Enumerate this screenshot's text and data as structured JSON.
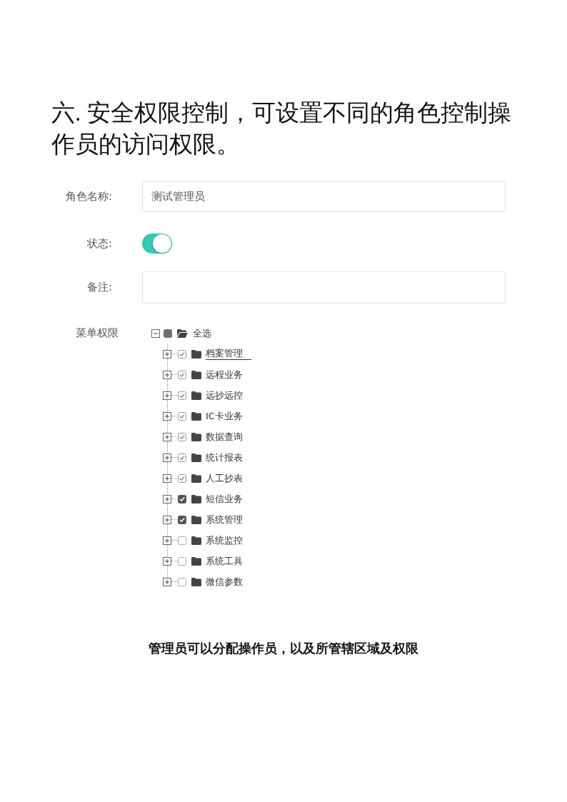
{
  "heading": "六. 安全权限控制，可设置不同的角色控制操作员的访问权限。",
  "form": {
    "role_name": {
      "label": "角色名称:",
      "value": "测试管理员"
    },
    "status": {
      "label": "状态:",
      "on": true
    },
    "remarks": {
      "label": "备注:"
    },
    "menu_permissions": {
      "label": "菜单权限",
      "tree": {
        "label": "全选",
        "expanded": true,
        "checked": false,
        "partial": true,
        "children": [
          {
            "label": "档案管理",
            "expanded": false,
            "checked": true,
            "partial": true,
            "hovered": true
          },
          {
            "label": "远程业务",
            "expanded": false,
            "checked": true,
            "partial": true,
            "hovered": false
          },
          {
            "label": "远抄远控",
            "expanded": false,
            "checked": true,
            "partial": true,
            "hovered": false
          },
          {
            "label": "IC卡业务",
            "expanded": false,
            "checked": true,
            "partial": true,
            "hovered": false
          },
          {
            "label": "数据查询",
            "expanded": false,
            "checked": true,
            "partial": true,
            "hovered": false
          },
          {
            "label": "统计报表",
            "expanded": false,
            "checked": true,
            "partial": true,
            "hovered": false
          },
          {
            "label": "人工抄表",
            "expanded": false,
            "checked": true,
            "partial": true,
            "hovered": false
          },
          {
            "label": "短信业务",
            "expanded": false,
            "checked": true,
            "partial": false,
            "hovered": false
          },
          {
            "label": "系统管理",
            "expanded": false,
            "checked": true,
            "partial": false,
            "hovered": false
          },
          {
            "label": "系统监控",
            "expanded": false,
            "checked": false,
            "partial": false,
            "hovered": false
          },
          {
            "label": "系统工具",
            "expanded": false,
            "checked": false,
            "partial": false,
            "hovered": false
          },
          {
            "label": "微信参数",
            "expanded": false,
            "checked": false,
            "partial": false,
            "hovered": false
          }
        ]
      }
    }
  },
  "caption": "管理员可以分配操作员，以及所管辖区域及权限"
}
